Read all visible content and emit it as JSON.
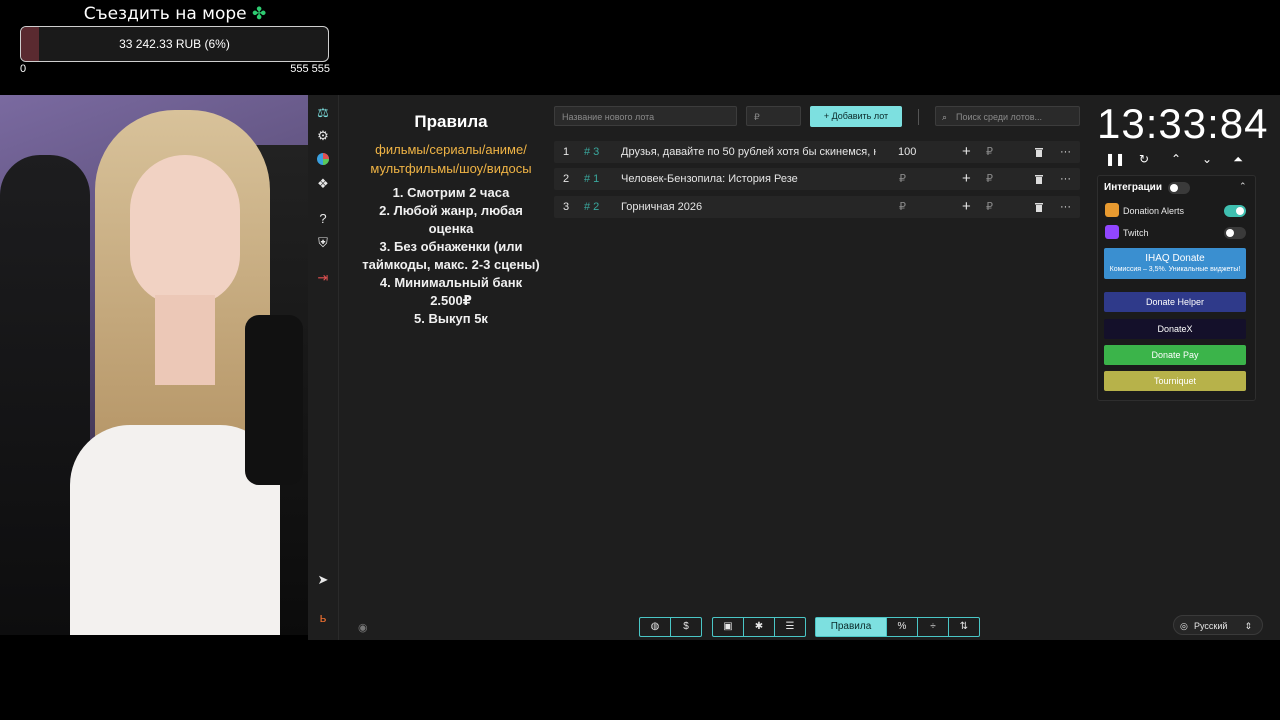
{
  "goal": {
    "title": "Съездить на море",
    "clover_icon": "four-leaf-clover-icon",
    "progress_label": "33 242.33 RUB (6%)",
    "progress_fraction": 0.06,
    "min": "0",
    "max": "555 555",
    "fill_color": "#5a2a30"
  },
  "sidebar": {
    "icons": [
      "auction-gavel-icon",
      "gear-icon",
      "pie-chart-icon",
      "layers-icon",
      "help-icon",
      "shield-check-icon",
      "logout-icon",
      "telegram-icon",
      "boosty-icon"
    ]
  },
  "rules": {
    "title": "Правила",
    "genres": "фильмы/сериалы/аниме/мультфильмы/шоу/видосы",
    "items": [
      "1. Смотрим 2 часа",
      "2. Любой жанр, любая оценка",
      "3. Без обнаженки (или таймкоды, макс. 2-3 сцены)",
      "4. Минимальный банк 2.500₽",
      "5. Выкуп 5к"
    ]
  },
  "lot_input": {
    "name_placeholder": "Название нового лота",
    "amount_placeholder": "₽",
    "add_button": "Добавить лот",
    "search_placeholder": "Поиск среди лотов..."
  },
  "lots": [
    {
      "num": "1",
      "fast_id": "# 3",
      "name": "Друзья, давайте по 50 рублей хотя бы скинемся, н",
      "amount": "100",
      "currency": ""
    },
    {
      "num": "2",
      "fast_id": "# 1",
      "name": "Человек-Бензопила: История Резе",
      "amount": "",
      "currency": "₽"
    },
    {
      "num": "3",
      "fast_id": "# 2",
      "name": "Горничная 2026",
      "amount": "",
      "currency": "₽"
    }
  ],
  "lot_actions": {
    "plus": "+",
    "currency": "₽",
    "more": "···"
  },
  "timer": {
    "value": "13:33:84",
    "controls": [
      "pause-icon",
      "reset-icon",
      "chevron-up-icon",
      "chevron-down-icon",
      "double-chevron-up-icon"
    ]
  },
  "integrations": {
    "title": "Интеграции",
    "donation_alerts": "Donation Alerts",
    "twitch": "Twitch",
    "ihaq_title": "IHAQ Donate",
    "ihaq_sub": "Комиссия – 3,5%. Уникальные виджеты!",
    "donate_helper": "Donate Helper",
    "donatex": "DonateX",
    "donate_pay": "Donate Pay",
    "tourniquet": "Tourniquet",
    "colors": {
      "ihaq": "#3a8fd0",
      "donate_helper": "#2f3a8a",
      "donatex": "#14102a",
      "donate_pay": "#3bb44a",
      "tourniquet": "#b7b24a"
    }
  },
  "bottom": {
    "rules_tab": "Правила",
    "language": "Русский"
  }
}
